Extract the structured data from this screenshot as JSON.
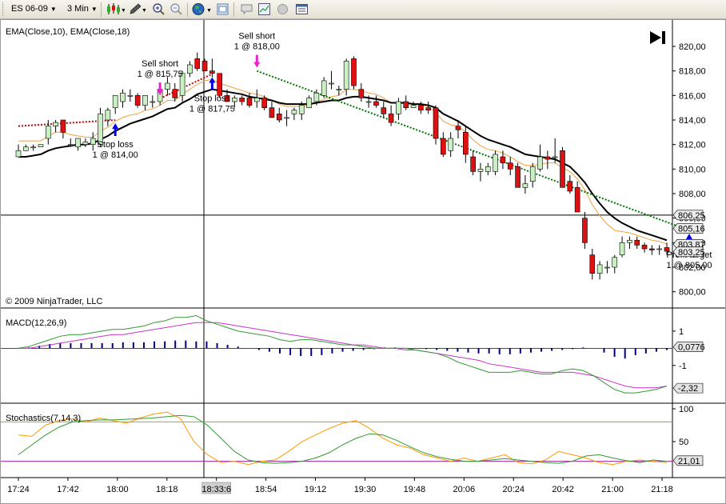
{
  "toolbar": {
    "instrument": "ES 06-09",
    "interval": "3 Min",
    "icons": [
      "candlestick-icon",
      "pencil-icon",
      "zoom-in-icon",
      "zoom-out-icon",
      "globe-icon",
      "properties-icon",
      "chat-icon",
      "chart-trader-icon",
      "record-icon",
      "data-box-icon"
    ]
  },
  "colors": {
    "up": "#c8f0c0",
    "down": "#dd1111",
    "ema10": "#f0a040",
    "ema18": "#000000",
    "macd": "#339933",
    "macd_avg": "#cc33cc",
    "hist": "#000080",
    "stoch_d": "#339933",
    "stoch_k": "#ff9900",
    "trade_loss": "#cc0000",
    "trade_win": "#007700",
    "arrow_sell": "#ee22cc",
    "arrow_buy": "#0000ee"
  },
  "chart_data": [
    {
      "type": "candlestick",
      "title": "EMA(Close,10), EMA(Close,18)",
      "copyright": "© 2009 NinjaTrader, LLC",
      "ylim": [
        799.0,
        821.5
      ],
      "yticks": [
        "820,00",
        "818,00",
        "816,00",
        "814,00",
        "812,00",
        "810,00",
        "808,00",
        "806,00",
        "804,00",
        "802,00",
        "800,00"
      ],
      "price_tags": [
        "806,25",
        "805,16",
        "803,87",
        "803,25"
      ],
      "ohlc": [
        [
          811.0,
          812.0,
          811.0,
          811.5
        ],
        [
          811.5,
          812.0,
          811.5,
          811.8
        ],
        [
          811.8,
          812.0,
          811.5,
          811.8
        ],
        [
          811.8,
          812.0,
          811.8,
          812.0
        ],
        [
          812.5,
          814.0,
          812.0,
          813.5
        ],
        [
          813.5,
          814.0,
          813.0,
          813.8
        ],
        [
          814.0,
          814.0,
          812.5,
          813.0
        ],
        [
          812.0,
          812.5,
          811.8,
          812.0
        ],
        [
          811.8,
          812.5,
          811.5,
          812.5
        ],
        [
          812.0,
          812.5,
          811.8,
          812.2
        ],
        [
          812.0,
          813.0,
          811.5,
          812.5
        ],
        [
          812.0,
          815.0,
          811.8,
          814.5
        ],
        [
          814.0,
          815.0,
          813.5,
          814.8
        ],
        [
          815.0,
          816.0,
          814.5,
          816.0
        ],
        [
          815.5,
          816.5,
          815.0,
          816.2
        ],
        [
          816.0,
          816.5,
          815.5,
          816.0
        ],
        [
          816.0,
          816.2,
          815.0,
          815.2
        ],
        [
          815.2,
          816.0,
          814.8,
          816.0
        ],
        [
          815.5,
          816.0,
          815.0,
          815.5
        ],
        [
          815.5,
          816.8,
          815.2,
          816.5
        ],
        [
          816.5,
          817.5,
          816.0,
          817.0
        ],
        [
          816.5,
          817.0,
          815.5,
          815.8
        ],
        [
          816.0,
          818.0,
          815.5,
          817.8
        ],
        [
          817.8,
          818.8,
          817.5,
          818.5
        ],
        [
          819.0,
          819.5,
          818.0,
          818.2
        ],
        [
          818.8,
          819.0,
          818.0,
          818.0
        ],
        [
          818.0,
          819.0,
          817.5,
          817.8
        ],
        [
          817.8,
          817.8,
          815.8,
          816.0
        ],
        [
          816.0,
          816.5,
          815.5,
          815.5
        ],
        [
          815.5,
          816.0,
          815.0,
          815.8
        ],
        [
          815.8,
          816.0,
          815.2,
          815.5
        ],
        [
          815.8,
          816.2,
          815.0,
          815.2
        ],
        [
          815.5,
          816.5,
          815.0,
          815.8
        ],
        [
          815.8,
          816.0,
          814.8,
          815.0
        ],
        [
          815.0,
          815.5,
          814.2,
          814.2
        ],
        [
          814.5,
          815.0,
          813.8,
          814.0
        ],
        [
          814.2,
          814.8,
          813.5,
          814.2
        ],
        [
          814.5,
          815.0,
          814.0,
          814.8
        ],
        [
          814.5,
          815.5,
          814.0,
          815.2
        ],
        [
          815.0,
          816.0,
          815.0,
          815.8
        ],
        [
          815.5,
          816.5,
          815.2,
          816.2
        ],
        [
          816.0,
          817.5,
          815.8,
          817.2
        ],
        [
          817.0,
          818.0,
          816.5,
          817.0
        ],
        [
          816.5,
          816.8,
          816.0,
          816.5
        ],
        [
          816.5,
          819.0,
          816.0,
          818.8
        ],
        [
          819.0,
          819.2,
          816.5,
          816.8
        ],
        [
          816.5,
          817.0,
          815.5,
          815.8
        ],
        [
          815.5,
          816.0,
          815.0,
          815.5
        ],
        [
          815.5,
          816.0,
          815.0,
          815.2
        ],
        [
          815.0,
          815.5,
          814.2,
          814.5
        ],
        [
          814.5,
          815.2,
          813.5,
          813.8
        ],
        [
          814.5,
          815.8,
          814.0,
          815.5
        ],
        [
          815.5,
          816.0,
          814.8,
          815.0
        ],
        [
          815.0,
          815.5,
          815.0,
          815.2
        ],
        [
          815.2,
          815.5,
          814.5,
          814.8
        ],
        [
          815.0,
          815.5,
          814.5,
          814.8
        ],
        [
          815.0,
          815.2,
          812.0,
          812.5
        ],
        [
          812.5,
          813.0,
          811.0,
          811.2
        ],
        [
          811.5,
          813.0,
          811.0,
          812.5
        ],
        [
          813.5,
          814.0,
          812.5,
          813.2
        ],
        [
          813.0,
          813.5,
          810.5,
          811.2
        ],
        [
          811.0,
          811.5,
          809.5,
          809.8
        ],
        [
          809.8,
          810.5,
          809.0,
          810.0
        ],
        [
          809.8,
          810.5,
          809.5,
          810.2
        ],
        [
          809.8,
          811.5,
          809.5,
          811.2
        ],
        [
          811.0,
          811.5,
          810.0,
          810.5
        ],
        [
          810.5,
          811.0,
          809.5,
          810.0
        ],
        [
          810.2,
          810.5,
          808.5,
          808.5
        ],
        [
          808.5,
          809.5,
          808.0,
          808.8
        ],
        [
          809.0,
          810.5,
          808.5,
          810.2
        ],
        [
          810.0,
          812.0,
          809.8,
          811.0
        ],
        [
          811.0,
          811.5,
          810.0,
          810.8
        ],
        [
          811.0,
          812.5,
          810.5,
          811.0
        ],
        [
          811.5,
          811.8,
          808.5,
          808.5
        ],
        [
          809.0,
          809.5,
          808.0,
          808.2
        ],
        [
          808.5,
          809.0,
          806.5,
          806.5
        ],
        [
          806.0,
          806.5,
          803.5,
          804.0
        ],
        [
          803.0,
          803.5,
          801.0,
          801.5
        ],
        [
          801.5,
          802.5,
          801.0,
          802.2
        ],
        [
          802.0,
          802.5,
          801.5,
          802.0
        ],
        [
          802.0,
          803.0,
          801.5,
          802.8
        ],
        [
          803.0,
          804.5,
          802.8,
          804.0
        ],
        [
          804.0,
          804.5,
          803.5,
          804.2
        ],
        [
          804.2,
          804.5,
          803.5,
          803.8
        ],
        [
          803.8,
          804.0,
          803.2,
          803.5
        ],
        [
          803.5,
          803.8,
          803.0,
          803.4
        ],
        [
          803.5,
          803.8,
          803.0,
          803.5
        ],
        [
          803.6,
          804.0,
          803.0,
          803.3
        ]
      ],
      "ema10": [
        812.3,
        812.3,
        812.3,
        812.3,
        812.7,
        813.0,
        813.0,
        812.8,
        812.7,
        812.6,
        812.6,
        813.1,
        813.4,
        813.9,
        814.2,
        814.4,
        814.5,
        814.8,
        814.9,
        815.2,
        815.6,
        815.6,
        816.1,
        816.5,
        816.9,
        817.2,
        817.3,
        817.0,
        816.8,
        816.6,
        816.4,
        816.2,
        816.1,
        815.9,
        815.6,
        815.3,
        815.1,
        815.1,
        815.1,
        815.2,
        815.4,
        815.7,
        815.9,
        816.0,
        816.5,
        816.5,
        816.4,
        816.2,
        816.1,
        815.8,
        815.4,
        815.4,
        815.3,
        815.3,
        815.2,
        815.1,
        814.6,
        813.9,
        813.6,
        813.5,
        813.0,
        812.4,
        811.9,
        811.6,
        811.5,
        811.3,
        811.0,
        810.6,
        810.3,
        810.3,
        810.4,
        810.5,
        810.5,
        810.1,
        809.8,
        809.2,
        808.3,
        807.1,
        806.2,
        805.5,
        805.0,
        804.9,
        804.8,
        804.6,
        804.4,
        804.2,
        804.1,
        803.9
      ],
      "ema18": [
        811.0,
        811.0,
        811.1,
        811.2,
        811.5,
        811.7,
        811.8,
        811.9,
        812.0,
        812.0,
        812.1,
        812.4,
        812.7,
        813.1,
        813.4,
        813.7,
        813.9,
        814.1,
        814.3,
        814.6,
        814.9,
        815.0,
        815.4,
        815.7,
        816.1,
        816.3,
        816.5,
        816.4,
        816.3,
        816.2,
        816.1,
        815.9,
        815.8,
        815.7,
        815.6,
        815.4,
        815.3,
        815.3,
        815.3,
        815.3,
        815.4,
        815.5,
        815.6,
        815.6,
        815.8,
        815.9,
        815.9,
        815.8,
        815.7,
        815.6,
        815.4,
        815.4,
        815.4,
        815.3,
        815.3,
        815.2,
        815.0,
        814.5,
        814.2,
        813.9,
        813.5,
        813.1,
        812.7,
        812.4,
        812.2,
        812.0,
        811.8,
        811.5,
        811.2,
        811.1,
        811.0,
        810.9,
        810.8,
        810.5,
        810.2,
        809.6,
        808.9,
        808.0,
        807.2,
        806.5,
        806.0,
        805.6,
        805.3,
        805.0,
        804.8,
        804.6,
        804.4,
        804.2
      ],
      "annotations": [
        {
          "text": "Sell short",
          "text2": "1 @ 815,75",
          "kind": "sell",
          "bar": 19,
          "price": 815.75
        },
        {
          "text": "Stop loss",
          "text2": "1 @ 814,00",
          "kind": "buy",
          "bar": 13,
          "price": 814.0
        },
        {
          "text": "Sell short",
          "text2": "1 @ 818,00",
          "kind": "sell",
          "bar": 32,
          "price": 818.0
        },
        {
          "text": "Stop loss",
          "text2": "1 @ 817,75",
          "kind": "buy",
          "bar": 26,
          "price": 817.75
        },
        {
          "text": "Profit target",
          "text2": "1 @ 805,00",
          "kind": "buy",
          "bar": 90,
          "price": 805.0
        }
      ],
      "trade_lines": [
        {
          "from_bar": 0,
          "from_price": 813.5,
          "to_bar": 13,
          "to_price": 814.0,
          "result": "loss"
        },
        {
          "from_bar": 19,
          "from_price": 815.75,
          "to_bar": 26,
          "to_price": 817.75,
          "result": "loss"
        },
        {
          "from_bar": 32,
          "from_price": 818.0,
          "to_bar": 90,
          "to_price": 805.0,
          "result": "win"
        }
      ]
    },
    {
      "type": "line",
      "title": "MACD(12,26,9)",
      "ylim": [
        -3.2,
        2.3
      ],
      "yticks": [
        "1",
        "-1"
      ],
      "price_tags": [
        "0,0776",
        "-2,32"
      ],
      "macd": [
        0.0,
        0.1,
        0.3,
        0.5,
        0.7,
        0.8,
        0.8,
        0.9,
        1.0,
        1.1,
        1.1,
        1.2,
        1.3,
        1.5,
        1.6,
        1.8,
        1.8,
        1.9,
        1.6,
        1.4,
        1.2,
        1.0,
        0.9,
        0.8,
        0.7,
        0.5,
        0.4,
        0.5,
        0.5,
        0.4,
        0.3,
        0.2,
        0.2,
        0.1,
        0.0,
        0.0,
        0.0,
        0.0,
        -0.1,
        -0.2,
        -0.3,
        -0.5,
        -0.8,
        -1.0,
        -1.2,
        -1.4,
        -1.4,
        -1.4,
        -1.3,
        -1.4,
        -1.5,
        -1.5,
        -1.3,
        -1.2,
        -1.3,
        -1.6,
        -2.0,
        -2.4,
        -2.6,
        -2.6,
        -2.5,
        -2.4,
        -2.2
      ],
      "signal": [
        0.0,
        0.0,
        0.1,
        0.2,
        0.3,
        0.4,
        0.5,
        0.6,
        0.7,
        0.8,
        0.8,
        0.9,
        1.0,
        1.1,
        1.2,
        1.3,
        1.4,
        1.5,
        1.5,
        1.5,
        1.4,
        1.3,
        1.2,
        1.1,
        1.0,
        0.9,
        0.8,
        0.7,
        0.6,
        0.5,
        0.4,
        0.3,
        0.2,
        0.2,
        0.1,
        0.0,
        0.0,
        -0.1,
        -0.1,
        -0.2,
        -0.3,
        -0.4,
        -0.5,
        -0.6,
        -0.7,
        -0.9,
        -1.0,
        -1.1,
        -1.2,
        -1.3,
        -1.4,
        -1.4,
        -1.4,
        -1.4,
        -1.5,
        -1.6,
        -1.8,
        -2.0,
        -2.2,
        -2.3,
        -2.3,
        -2.3,
        -2.2
      ],
      "histogram": [
        0.0,
        0.05,
        0.15,
        0.25,
        0.3,
        0.3,
        0.3,
        0.3,
        0.3,
        0.3,
        0.35,
        0.35,
        0.35,
        0.4,
        0.4,
        0.45,
        0.45,
        0.4,
        0.4,
        0.3,
        0.2,
        0.1,
        0.0,
        -0.1,
        -0.2,
        -0.3,
        -0.4,
        -0.45,
        -0.45,
        -0.4,
        -0.3,
        -0.2,
        -0.15,
        -0.1,
        -0.05,
        0.05,
        0.05,
        0.0,
        0.0,
        -0.05,
        -0.1,
        -0.15,
        -0.2,
        -0.25,
        -0.3,
        -0.3,
        -0.35,
        -0.35,
        -0.3,
        -0.25,
        -0.2,
        -0.15,
        -0.1,
        -0.05,
        0.05,
        0.0,
        -0.25,
        -0.5,
        -0.6,
        -0.4,
        -0.3,
        -0.2,
        -0.1
      ]
    },
    {
      "type": "line",
      "title": "Stochastics(7,14,3)",
      "ylim": [
        0,
        100
      ],
      "yticks": [
        "100",
        "50"
      ],
      "levels": [
        80,
        20
      ],
      "price_tags": [
        "21,01"
      ],
      "d": [
        30,
        45,
        60,
        72,
        80,
        82,
        83,
        83,
        84,
        85,
        86,
        88,
        90,
        88,
        75,
        55,
        35,
        22,
        18,
        17,
        18,
        20,
        25,
        33,
        45,
        55,
        62,
        60,
        52,
        42,
        33,
        27,
        23,
        20,
        20,
        22,
        24,
        22,
        20,
        18,
        17,
        20,
        28,
        30,
        25,
        21,
        18,
        22,
        20
      ],
      "k": [
        60,
        58,
        75,
        82,
        85,
        80,
        86,
        82,
        78,
        86,
        92,
        95,
        85,
        50,
        30,
        18,
        20,
        15,
        20,
        22,
        35,
        50,
        60,
        70,
        78,
        82,
        70,
        55,
        45,
        40,
        30,
        25,
        20,
        25,
        20,
        25,
        30,
        18,
        16,
        22,
        35,
        30,
        25,
        18,
        15,
        20,
        22,
        20,
        18
      ],
      "x_labels": [
        "17:24",
        "17:42",
        "18:00",
        "18:18",
        "18:33:6",
        "18:54",
        "19:12",
        "19:30",
        "19:48",
        "20:06",
        "20:24",
        "20:42",
        "21:00",
        "21:18"
      ]
    }
  ]
}
